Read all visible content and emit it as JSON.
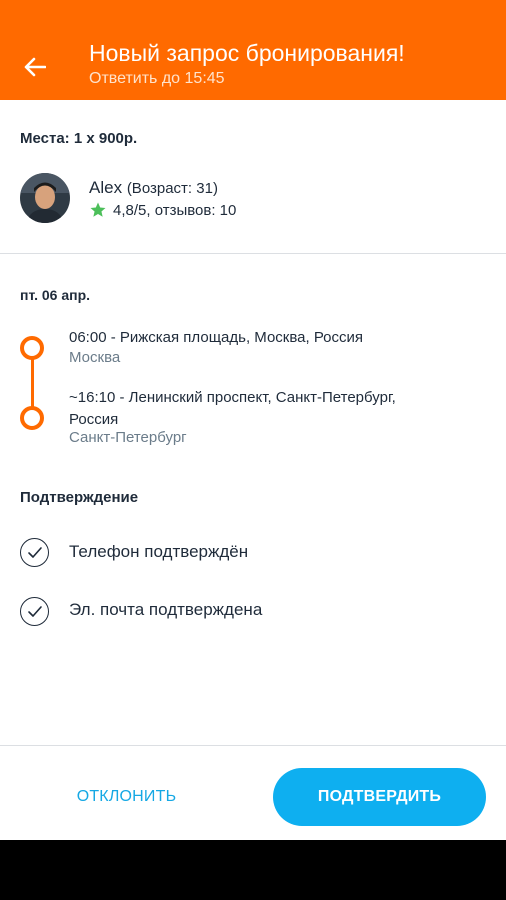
{
  "header": {
    "title": "Новый запрос бронирования!",
    "subtitle": "Ответить до 15:45",
    "back_icon": "arrow-left-icon",
    "background": "#ff6a00"
  },
  "booking": {
    "seats": "Места: 1 x 900р."
  },
  "passenger": {
    "name": "Alex",
    "age": "(Возраст: 31)",
    "rating": "4,8/5, отзывов: 10",
    "rating_icon": "star-icon",
    "star_color": "#4cbf5a"
  },
  "trip": {
    "date": "пт. 06 апр.",
    "stops": [
      {
        "main": "06:00 - Рижская площадь, Москва, Россия",
        "city": "Москва"
      },
      {
        "main": "~16:10 - Ленинский проспект, Санкт-Петербург, Россия",
        "city": "Санкт-Петербург"
      }
    ],
    "route_color": "#ff6a00"
  },
  "verification": {
    "title": "Подтверждение",
    "items": [
      {
        "label": "Телефон подтверждён",
        "icon": "check-circle-icon"
      },
      {
        "label": "Эл. почта подтверждена",
        "icon": "check-circle-icon"
      }
    ]
  },
  "actions": {
    "decline_label": "ОТКЛОНИТЬ",
    "confirm_label": "ПОДТВЕРДИТЬ",
    "accent": "#0eaff0"
  }
}
